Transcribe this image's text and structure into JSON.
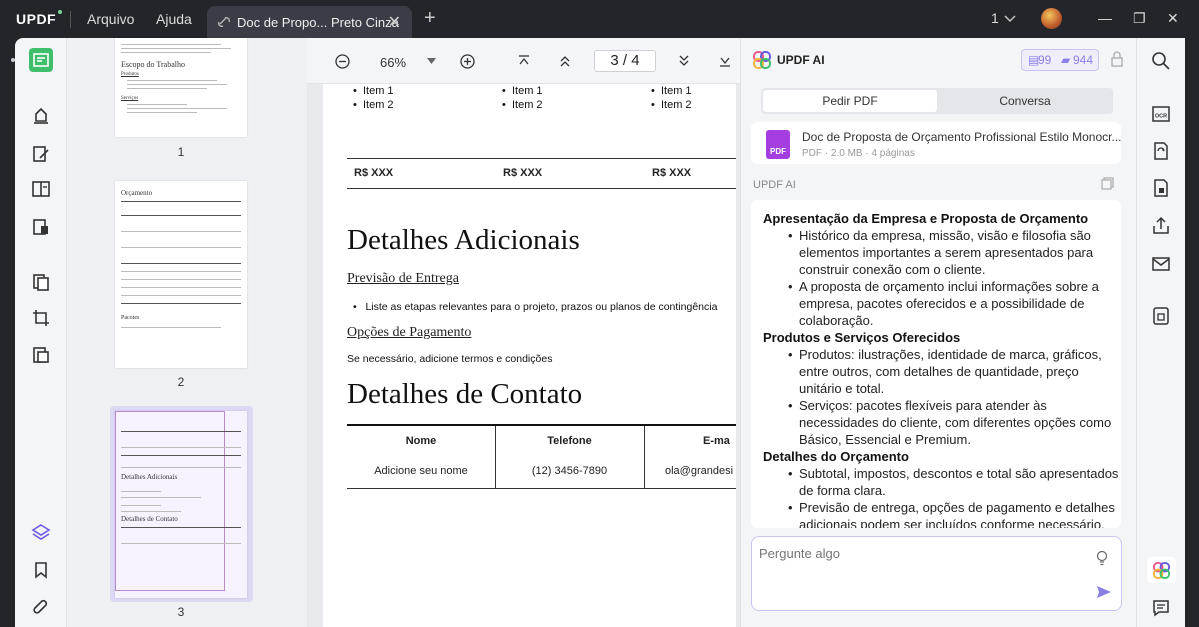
{
  "titlebar": {
    "logo": "UPDF",
    "menu": [
      "Arquivo",
      "Ajuda"
    ],
    "tab_title": "Doc de Propo... Preto Cinza",
    "close": "✕",
    "new_tab": "+",
    "page_count": "1",
    "minimize": "—",
    "maximize": "❐",
    "close_window": "✕"
  },
  "toolbar": {
    "icons": [
      "reader-icon",
      "comment-icon",
      "edit-icon",
      "page-organize-icon",
      "form-icon",
      "convert-icon",
      "crop-icon",
      "protect-icon",
      "layers-icon",
      "bookmark-icon",
      "attachment-icon"
    ]
  },
  "thumbnails": [
    {
      "number": "1",
      "heading": "Escopo do Trabalho",
      "sub1": "Produtos",
      "sub2": "Serviços"
    },
    {
      "number": "2",
      "heading": "Orçamento",
      "footer": "Pacotes"
    },
    {
      "number": "3",
      "heading1": "Detalhes Adicionais",
      "heading2": "Detalhes de Contato"
    }
  ],
  "viewer": {
    "zoom": "66%",
    "current_page": "3",
    "page_separator": "/",
    "total_pages": "4"
  },
  "page": {
    "items": [
      "Item 1",
      "Item 2"
    ],
    "price": "R$ XXX",
    "h1": "Detalhes Adicionais",
    "h2a": "Previsão de Entrega",
    "bullet": "Liste as etapas relevantes para o projeto, prazos ou planos de contingência",
    "h2b": "Opções de Pagamento",
    "para": "Se necessário, adicione termos e condições",
    "h1b": "Detalhes de Contato",
    "table": {
      "headers": [
        "Nome",
        "Telefone",
        "E-ma"
      ],
      "row": [
        "Adicione seu nome",
        "(12) 3456-7890",
        "ola@grandesi"
      ]
    }
  },
  "ai": {
    "title": "UPDF AI",
    "credits1": "99",
    "credits2": "944",
    "tab_active": "Pedir PDF",
    "tab_other": "Conversa",
    "file_name": "Doc de Proposta de Orçamento Profissional Estilo Monocr...",
    "file_meta": "PDF · 2.0 MB · 4 páginas",
    "section_label": "UPDF AI",
    "answer": [
      {
        "h": "Apresentação da Empresa e Proposta de Orçamento"
      },
      {
        "b": "Histórico da empresa, missão, visão e filosofia são elementos importantes a serem apresentados para construir conexão com o cliente."
      },
      {
        "b": "A proposta de orçamento inclui informações sobre a empresa, pacotes oferecidos e a possibilidade de colaboração."
      },
      {
        "h": "Produtos e Serviços Oferecidos"
      },
      {
        "b": "Produtos: ilustrações, identidade de marca, gráficos, entre outros, com detalhes de quantidade, preço unitário e total."
      },
      {
        "b": "Serviços: pacotes flexíveis para atender às necessidades do cliente, com diferentes opções como Básico, Essencial e Premium."
      },
      {
        "h": "Detalhes do Orçamento"
      },
      {
        "b": "Subtotal, impostos, descontos e total são apresentados de forma clara."
      },
      {
        "b": "Previsão de entrega, opções de pagamento e detalhes adicionais podem ser incluídos conforme necessário."
      }
    ],
    "placeholder": "Pergunte algo"
  }
}
